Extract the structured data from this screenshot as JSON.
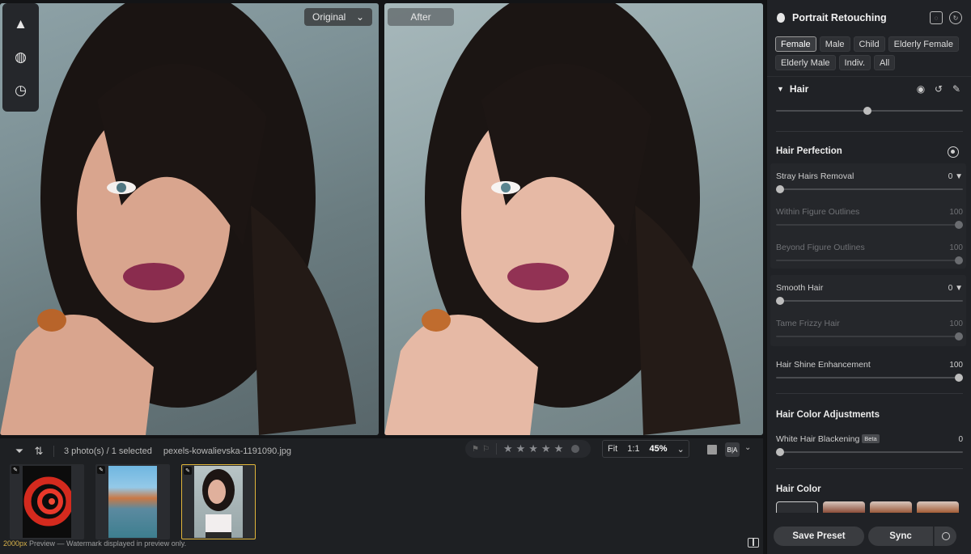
{
  "viewer": {
    "original_label": "Original",
    "after_label": "After",
    "watermark_size": "2000px",
    "watermark_text": "Preview — Watermark displayed in preview only."
  },
  "tools": [
    {
      "icon": "landscape-icon"
    },
    {
      "icon": "texture-icon"
    },
    {
      "icon": "history-icon"
    }
  ],
  "filmstrip": {
    "count_text": "3 photo(s) / 1 selected",
    "filename": "pexels-kowalievska-1191090.jpg",
    "fit_label": "Fit",
    "one_to_one_label": "1:1",
    "zoom_value": "45%",
    "ba_label": "B|A",
    "stars_total": 5,
    "thumbnails": [
      {
        "name": "red-spiral-staircase",
        "selected": false
      },
      {
        "name": "colorful-waterfront",
        "selected": false
      },
      {
        "name": "portrait-woman",
        "selected": true
      }
    ]
  },
  "panel": {
    "title": "Portrait Retouching",
    "chips": [
      {
        "label": "Female",
        "active": true
      },
      {
        "label": "Male",
        "active": false
      },
      {
        "label": "Child",
        "active": false
      },
      {
        "label": "Elderly Female",
        "active": false
      },
      {
        "label": "Elderly Male",
        "active": false
      },
      {
        "label": "Indiv.",
        "active": false
      },
      {
        "label": "All",
        "active": false
      }
    ],
    "hair_section": "Hair",
    "hair_perfection": "Hair Perfection",
    "stray_hairs": {
      "label": "Stray Hairs Removal",
      "value": "0"
    },
    "within_outlines": {
      "label": "Within Figure Outlines",
      "value": "100"
    },
    "beyond_outlines": {
      "label": "Beyond Figure Outlines",
      "value": "100"
    },
    "smooth_hair": {
      "label": "Smooth Hair",
      "value": "0"
    },
    "tame_frizzy": {
      "label": "Tame Frizzy Hair",
      "value": "100"
    },
    "shine": {
      "label": "Hair Shine Enhancement",
      "value": "100"
    },
    "color_adjust": "Hair Color Adjustments",
    "white_hair": {
      "label": "White Hair Blackening",
      "beta": "Beta",
      "value": "0"
    },
    "hair_color": "Hair Color",
    "save_preset": "Save Preset",
    "sync": "Sync"
  },
  "colors": {
    "selection": "#e0b53a",
    "panel_bg": "#202226"
  }
}
